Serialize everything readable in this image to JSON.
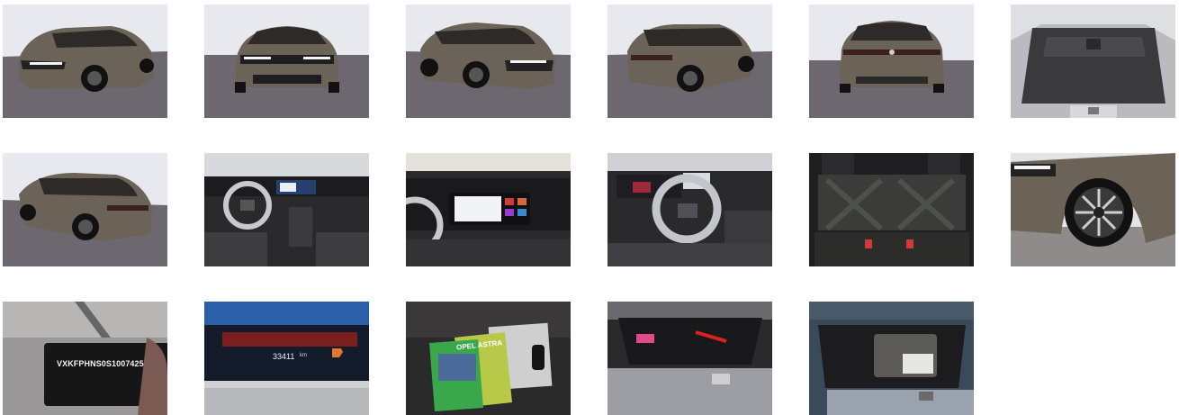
{
  "gallery": {
    "photos": [
      {
        "name": "car-front-left-three-quarter"
      },
      {
        "name": "car-front"
      },
      {
        "name": "car-front-right-three-quarter"
      },
      {
        "name": "car-rear-left-three-quarter"
      },
      {
        "name": "car-rear"
      },
      {
        "name": "boot-interior"
      },
      {
        "name": "car-rear-right-three-quarter"
      },
      {
        "name": "dashboard-interior"
      },
      {
        "name": "infotainment-screen"
      },
      {
        "name": "steering-wheel-interior"
      },
      {
        "name": "rear-seats"
      },
      {
        "name": "wheel-detail"
      },
      {
        "name": "vin-card",
        "vin_text": "VXKFPHNS0S1007425"
      },
      {
        "name": "odometer",
        "mileage": "33411",
        "unit": "km"
      },
      {
        "name": "manuals-and-keys",
        "booklet_title": "OPEL ASTRA"
      },
      {
        "name": "underfloor-storage"
      },
      {
        "name": "tyre-repair-kit"
      }
    ]
  },
  "colors": {
    "car_body": "#6b6358",
    "studio_floor": "#6d6870",
    "studio_wall": "#e8e9ee",
    "interior_dark": "#2a2a2c",
    "screen_blue": "#2b5fa8",
    "accent_red": "#d23a3a"
  }
}
